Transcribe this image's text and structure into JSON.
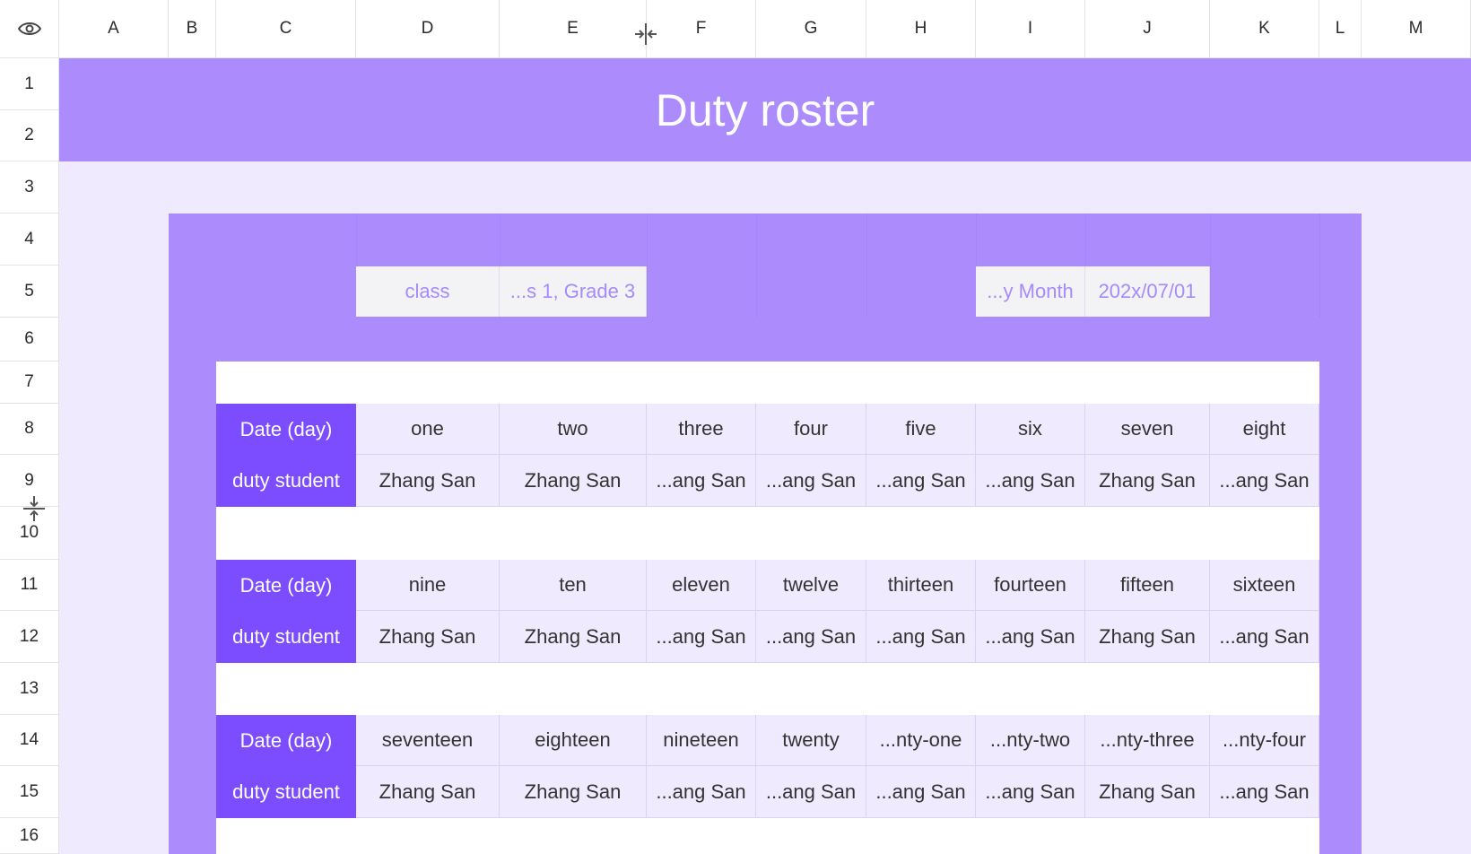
{
  "column_headers": [
    "A",
    "B",
    "C",
    "D",
    "E",
    "F",
    "G",
    "H",
    "I",
    "J",
    "K",
    "L",
    "M"
  ],
  "row_headers": [
    "1",
    "2",
    "3",
    "4",
    "5",
    "6",
    "7",
    "8",
    "9",
    "10",
    "11",
    "12",
    "13",
    "14",
    "15",
    "16"
  ],
  "title": "Duty roster",
  "meta": {
    "class_label": "class",
    "class_value": "...s 1, Grade 3",
    "month_label": "...y Month",
    "month_value": "202x/07/01"
  },
  "blocks": [
    {
      "date_label": "Date (day)",
      "duty_label": "duty student",
      "days": [
        "one",
        "two",
        "three",
        "four",
        "five",
        "six",
        "seven",
        "eight"
      ],
      "students": [
        "Zhang San",
        "Zhang San",
        "...ang San",
        "...ang San",
        "...ang San",
        "...ang San",
        "Zhang San",
        "...ang San"
      ]
    },
    {
      "date_label": "Date (day)",
      "duty_label": "duty student",
      "days": [
        "nine",
        "ten",
        "eleven",
        "twelve",
        "thirteen",
        "fourteen",
        "fifteen",
        "sixteen"
      ],
      "students": [
        "Zhang San",
        "Zhang San",
        "...ang San",
        "...ang San",
        "...ang San",
        "...ang San",
        "Zhang San",
        "...ang San"
      ]
    },
    {
      "date_label": "Date (day)",
      "duty_label": "duty student",
      "days": [
        "seventeen",
        "eighteen",
        "nineteen",
        "twenty",
        "...nty-one",
        "...nty-two",
        "...nty-three",
        "...nty-four"
      ],
      "students": [
        "Zhang San",
        "Zhang San",
        "...ang San",
        "...ang San",
        "...ang San",
        "...ang San",
        "Zhang San",
        "...ang San"
      ]
    }
  ],
  "colors": {
    "accent": "#7c4dff",
    "band": "#ac8bfd",
    "light_band": "#efeafe",
    "meta_text": "#a58bfb"
  },
  "icons": {
    "select_all": "eye-icon",
    "column_resize": "column-resize-icon",
    "row_resize": "row-resize-icon"
  }
}
